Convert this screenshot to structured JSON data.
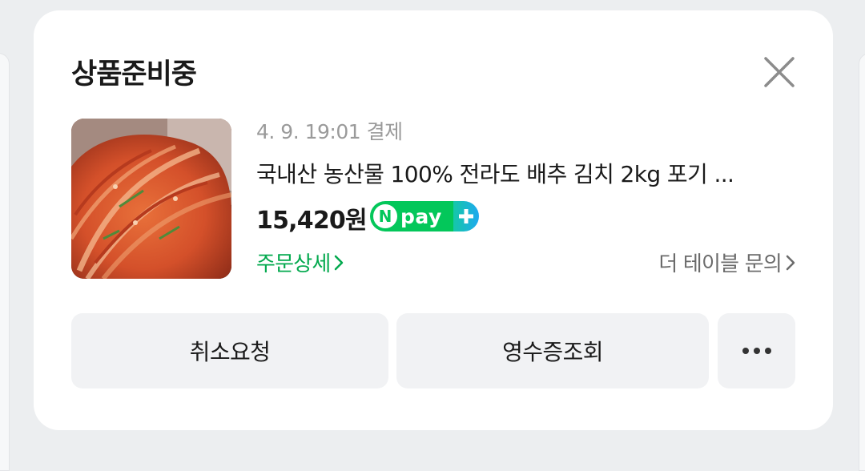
{
  "order": {
    "status": "상품준비중",
    "payment_datetime": "4. 9. 19:01 결제",
    "product_name": "국내산 농산물 100% 전라도 배추 김치 2kg 포기 ...",
    "price": "15,420원",
    "pay_badge": {
      "n": "N",
      "word": "pay",
      "plus": "+"
    },
    "order_detail_link": "주문상세",
    "seller_inquiry_link": "더 테이블 문의"
  },
  "actions": {
    "cancel_label": "취소요청",
    "receipt_label": "영수증조회"
  },
  "icons": {
    "close": "close-icon",
    "chevron": "chevron-right-icon",
    "more": "more-horizontal-icon"
  },
  "colors": {
    "naver_green": "#03c75a",
    "link_green": "#03a94e",
    "secondary_text": "#9a9a9a",
    "button_bg": "#f1f2f4"
  }
}
